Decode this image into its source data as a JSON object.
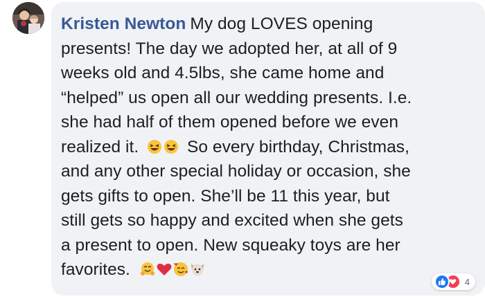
{
  "comment": {
    "author": "Kristen Newton",
    "lines": [
      "My dog LOVES opening",
      "presents! The day we adopted her, at all of 9",
      "weeks old and 4.5lbs, she came home and",
      "“helped” us open all our wedding presents. I.e.",
      "she had half of them opened before we even",
      "realized it.",
      "So every birthday, Christmas,",
      "and any other special holiday or occasion, she",
      "gets gifts to open. She’ll be 11 this year, but",
      "still gets so happy and excited when she gets",
      "a present to open. New squeaky toys are her",
      "favorites."
    ],
    "inline_emojis_line6": [
      "grinning-squinting-face",
      "grinning-squinting-face"
    ],
    "inline_emojis_end": [
      "smiling-face-with-hearts-hug",
      "red-heart",
      "smiling-face-with-hearts",
      "dog-face"
    ]
  },
  "reactions": {
    "icons": [
      "like-icon",
      "love-icon"
    ],
    "count": "4",
    "colors": {
      "like": "#2078f4",
      "love": "#f33e58"
    }
  },
  "colors": {
    "author": "#385898",
    "text": "#1c1e21",
    "bubble": "#f0f2f5"
  }
}
